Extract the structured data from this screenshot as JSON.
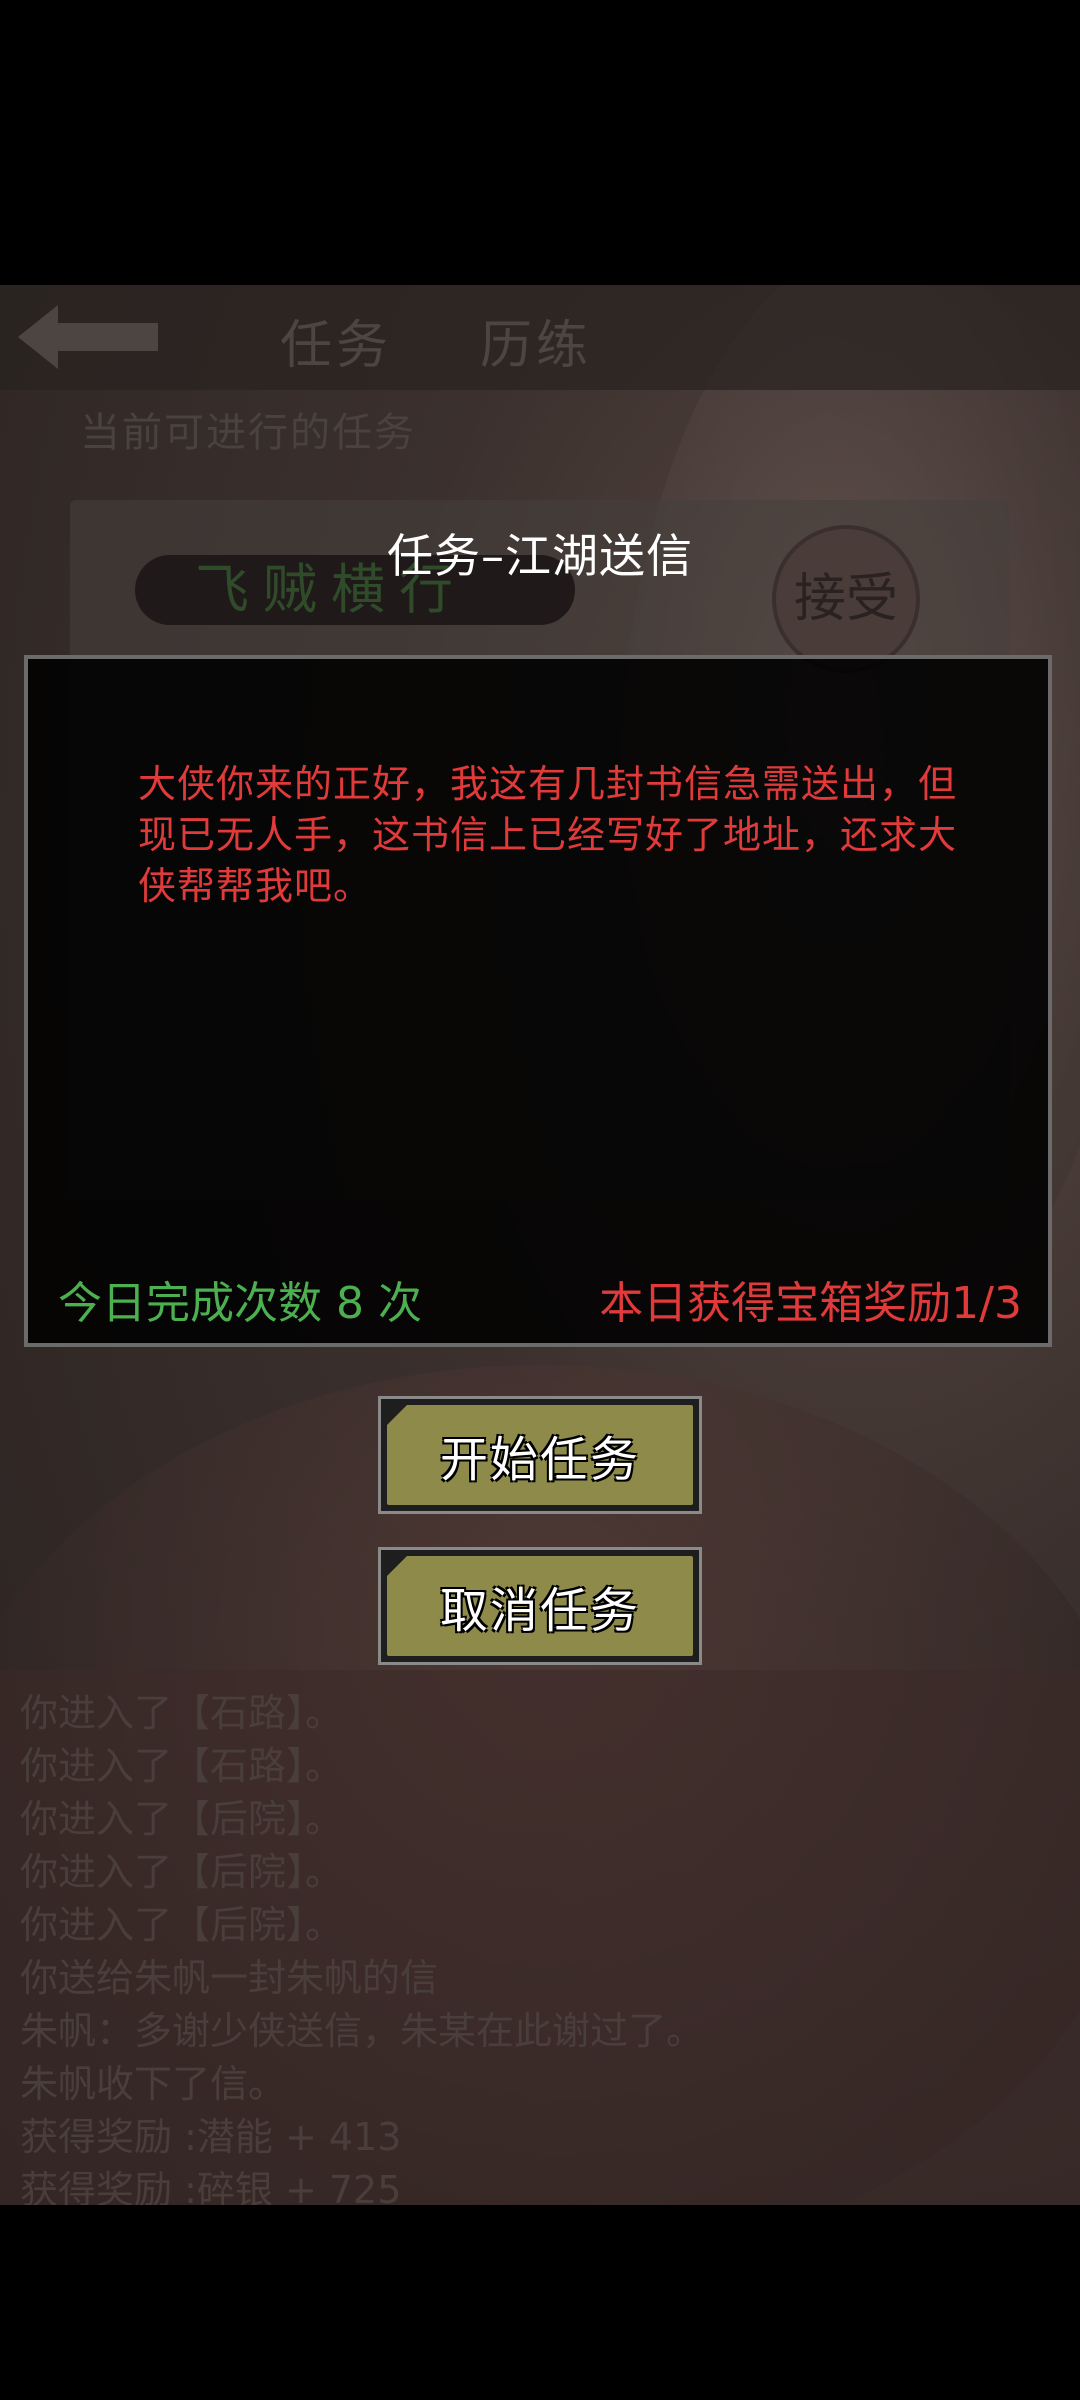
{
  "background": {
    "back_label": "",
    "tabs": [
      "任务",
      "历练"
    ],
    "section_label": "当前可进行的任务",
    "task_name": "飞贼横行",
    "accept_label": "接受",
    "log": [
      "你进入了【石路】。",
      "你进入了【石路】。",
      "你进入了【后院】。",
      "你进入了【后院】。",
      "你进入了【后院】。",
      "你送给朱帆一封朱帆的信",
      "朱帆：多谢少侠送信，朱某在此谢过了。",
      "朱帆收下了信。",
      "获得奖励 :潜能 + 413",
      "获得奖励 :碎银 + 725"
    ]
  },
  "dialog": {
    "title": "任务–江湖送信",
    "message": "大侠你来的正好，我这有几封书信急需送出，但现已无人手，这书信上已经写好了地址，还求大侠帮帮我吧。",
    "completed_count": "今日完成次数 8 次",
    "reward_status": "本日获得宝箱奖励1/3"
  },
  "buttons": {
    "start": "开始任务",
    "cancel": "取消任务"
  },
  "colors": {
    "message": "#e03a3a",
    "count": "#4caf50",
    "button_fill": "#8d8a4a"
  }
}
